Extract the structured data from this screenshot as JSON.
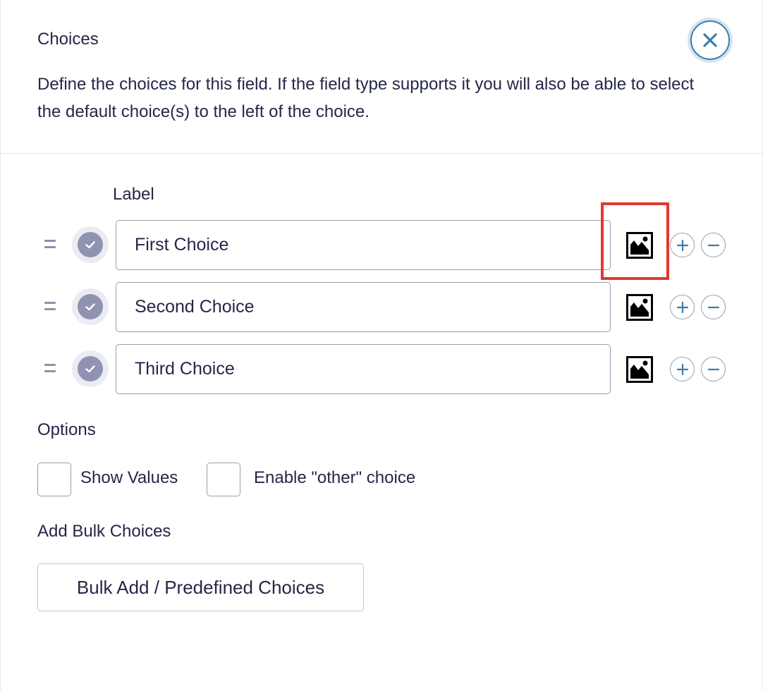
{
  "panel": {
    "title": "Choices",
    "description": "Define the choices for this field. If the field type supports it you will also be able to select the default choice(s) to the left of the choice.",
    "close_icon": "close-icon"
  },
  "choices": {
    "column_label": "Label",
    "items": [
      {
        "value": "First Choice"
      },
      {
        "value": "Second Choice"
      },
      {
        "value": "Third Choice"
      }
    ]
  },
  "options": {
    "heading": "Options",
    "show_values_label": "Show Values",
    "enable_other_label": "Enable \"other\" choice"
  },
  "bulk": {
    "heading": "Add Bulk Choices",
    "button_label": "Bulk Add / Predefined Choices"
  },
  "colors": {
    "accent": "#3e7da6",
    "highlight": "#e03a2f",
    "text": "#242748"
  }
}
